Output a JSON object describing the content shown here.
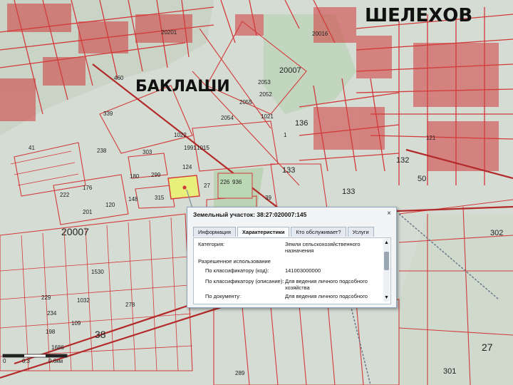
{
  "map": {
    "towns": {
      "shelekhov": "ШЕЛЕХОВ",
      "baklashi": "БАКЛАШИ"
    },
    "labels": {
      "n20201": "20201",
      "n20016": "20016",
      "n20007a": "20007",
      "n20007b": "20007",
      "n2053": "2053",
      "n2055": "2055",
      "n2054": "2054",
      "n2052": "2052",
      "n1021": "1021",
      "n460": "460",
      "n339": "339",
      "n41": "41",
      "n1022": "1022",
      "n1991": "1991",
      "n1015": "1015",
      "n238": "238",
      "n303": "303",
      "n124": "124",
      "n136": "136",
      "n133a": "133",
      "n133b": "133",
      "n50": "50",
      "n132": "132",
      "n121": "121",
      "n176": "176",
      "n180": "180",
      "n299": "299",
      "n222": "222",
      "n148": "148",
      "n315": "315",
      "n27": "27",
      "n226": "226",
      "n936": "936",
      "n201": "201",
      "n120": "120",
      "n39": "39",
      "n302": "302",
      "n1": "1",
      "n38": "38",
      "n229": "229",
      "n234": "234",
      "n109": "109",
      "n278": "278",
      "n1032": "1032",
      "n1530": "1530",
      "n1686": "1686",
      "n198": "198",
      "n289": "289",
      "n301": "301",
      "n27b": "27"
    },
    "scale": {
      "v0": "0",
      "v03": "0.3",
      "v06": "0.6км"
    },
    "colors": {
      "boundary": "#d23a3a",
      "parcel_fill": "#e8ef7a",
      "green": "#a9c7a0",
      "background": "#cfd7cf"
    }
  },
  "popup": {
    "title": "Земельный участок: 38:27:020007:145",
    "close_icon": "close-icon",
    "tabs": [
      "Информация",
      "Характеристики",
      "Кто обслуживает?",
      "Услуги"
    ],
    "active_tab": 1,
    "rows": {
      "category_label": "Категория:",
      "category_value_1": "Земли сельскохозяйственного",
      "category_value_2": "назначения",
      "permitted_use_label": "Разрешенное использование",
      "classifier_code_label": "По классификатору (код):",
      "classifier_code_value": "141003000000",
      "classifier_desc_label": "По классификатору (описание):",
      "classifier_desc_value_1": "Для ведения личного подсобного",
      "classifier_desc_value_2": "хозяйства",
      "document_label": "По документу:",
      "document_value": "Для ведения личного подсобного"
    }
  }
}
